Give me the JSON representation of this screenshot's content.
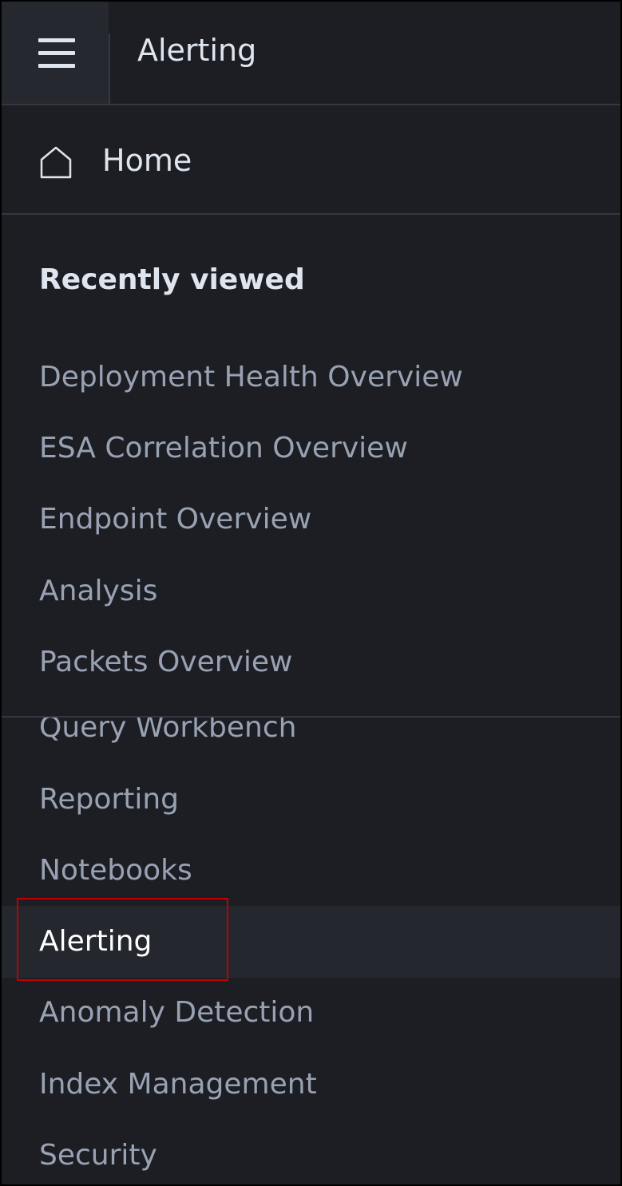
{
  "header": {
    "menu_icon": "hamburger-menu-icon",
    "title": "Alerting"
  },
  "home": {
    "icon": "home-icon",
    "label": "Home"
  },
  "recently_viewed": {
    "title": "Recently viewed",
    "items": [
      "Deployment Health Overview",
      "ESA Correlation Overview",
      "Endpoint Overview",
      "Analysis",
      "Packets Overview"
    ]
  },
  "nav": {
    "items": [
      {
        "label": "Query Workbench"
      },
      {
        "label": "Reporting"
      },
      {
        "label": "Notebooks"
      },
      {
        "label": "Alerting",
        "active": true
      },
      {
        "label": "Anomaly Detection"
      },
      {
        "label": "Index Management"
      },
      {
        "label": "Security"
      }
    ]
  },
  "colors": {
    "background": "#1d1e24",
    "text_primary": "#dfe5ef",
    "text_muted": "#98a2b3",
    "divider": "#343741",
    "highlight_border": "#c00000"
  }
}
